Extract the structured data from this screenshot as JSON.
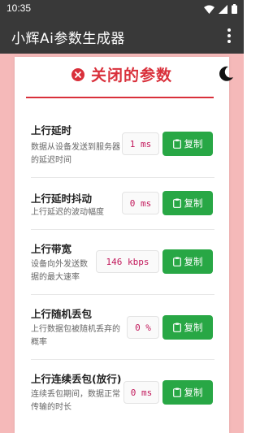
{
  "status": {
    "time": "10:35"
  },
  "app": {
    "title": "小辉Ai参数生成器"
  },
  "section": {
    "title": "关闭的参数"
  },
  "params": [
    {
      "name": "上行延时",
      "desc": "数据从设备发送到服务器\n的延迟时间",
      "value": "1 ms",
      "copy": "复制"
    },
    {
      "name": "上行延时抖动",
      "desc": "上行延迟的波动幅度",
      "value": "0 ms",
      "copy": "复制"
    },
    {
      "name": "上行带宽",
      "desc": "设备向外发送数\n据的最大速率",
      "value": "146 kbps",
      "copy": "复制"
    },
    {
      "name": "上行随机丢包",
      "desc": "上行数据包被随机丢弃的\n概率",
      "value": "0 %",
      "copy": "复制"
    },
    {
      "name": "上行连续丢包(放行)",
      "desc": "连续丢包期间，数据正常\n传输的时长",
      "value": "0 ms",
      "copy": "复制"
    }
  ],
  "colors": {
    "accent_red": "#d9303b",
    "copy_green": "#28a745",
    "app_bar": "#393939",
    "background_pink": "#f5b9b9"
  }
}
